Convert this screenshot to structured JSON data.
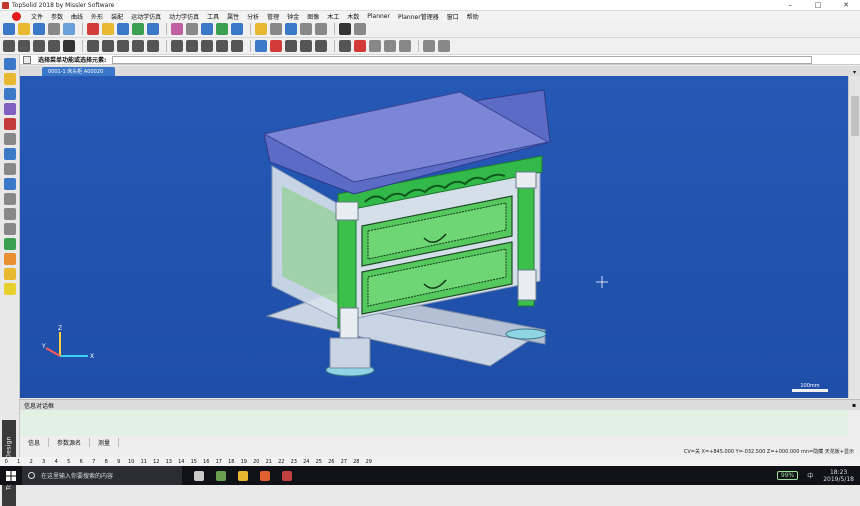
{
  "window": {
    "title": "TopSolid 2018 by Missler Software",
    "controls": [
      "–",
      "□",
      "✕"
    ]
  },
  "menu": {
    "items": [
      "文件",
      "参数",
      "曲线",
      "外形",
      "装配",
      "运动学仿真",
      "动力学仿真",
      "工具",
      "属性",
      "分析",
      "管理",
      "钟金",
      "图像",
      "木工",
      "木数",
      "Planner",
      "Planner管理器",
      "窗口",
      "帮助"
    ]
  },
  "toolbar1": {
    "colors": [
      "#3c78c8",
      "#e8b830",
      "#3c78c8",
      "#888888",
      "#6aa0d8",
      "#d33b3b",
      "#e8b830",
      "#3c78c8",
      "#3aa050",
      "#3c78c8",
      "#c060a0",
      "#888888",
      "#3c78c8",
      "#3aa050",
      "#3c78c8",
      "#e8b830",
      "#888888",
      "#3c78c8",
      "#888888",
      "#888888",
      "#333333",
      "#888888"
    ]
  },
  "toolbar2": {
    "colors": [
      "#555555",
      "#555555",
      "#555555",
      "#555555",
      "#333333",
      "#555555",
      "#555555",
      "#555555",
      "#555555",
      "#555555",
      "#555555",
      "#555555",
      "#555555",
      "#555555",
      "#555555",
      "#3c78c8",
      "#d33b3b",
      "#555555",
      "#555555",
      "#555555",
      "#555555",
      "#d33b3b",
      "#888888",
      "#888888",
      "#888888",
      "#888888",
      "#888888"
    ]
  },
  "leftbar": {
    "colors": [
      "#3c78c8",
      "#e8b830",
      "#3c78c8",
      "#8060c0",
      "#c33b3b",
      "#888888",
      "#3c78c8",
      "#888888",
      "#3c78c8",
      "#888888",
      "#888888",
      "#888888",
      "#3aa050",
      "#e89030",
      "#e8b830",
      "#e8d030"
    ],
    "label": "TopSolid' Design"
  },
  "command": {
    "prompt": "选择菜单功能或选择元素:"
  },
  "document_tab": {
    "label": "0001-1 床头柜 A00020"
  },
  "viewport": {
    "background": "#2155b0",
    "scale_label": "100mm",
    "axis_labels": {
      "x": "X",
      "y": "Y",
      "z": "Z"
    }
  },
  "info_panel": {
    "title": "信息对话框",
    "tabs": [
      "信息",
      "参数源名",
      "测量"
    ],
    "status": "CV=关  X=+845.000  Y=-032.500  Z=+000.000  mn=隐藏  天花板+显示"
  },
  "numbers": [
    "0",
    "1",
    "2",
    "3",
    "4",
    "5",
    "6",
    "7",
    "8",
    "9",
    "10",
    "11",
    "12",
    "13",
    "14",
    "15",
    "16",
    "17",
    "18",
    "19",
    "20",
    "21",
    "22",
    "23",
    "24",
    "25",
    "26",
    "27",
    "28",
    "29"
  ],
  "taskbar": {
    "search_placeholder": "在这里输入你要搜索的内容",
    "battery": "99%",
    "lang": "中",
    "time": "18:23",
    "date": "2019/5/18",
    "app_colors": [
      "#cccccc",
      "#6aa050",
      "#e8b830",
      "#e06030",
      "#c04040"
    ]
  }
}
